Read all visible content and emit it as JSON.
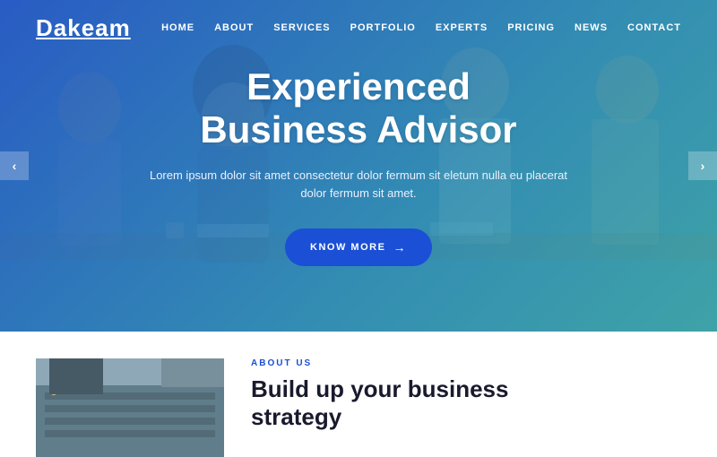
{
  "header": {
    "logo": "Dakeam",
    "nav": [
      {
        "label": "HOME"
      },
      {
        "label": "ABOUT"
      },
      {
        "label": "SERVICES"
      },
      {
        "label": "PORTFOLIO"
      },
      {
        "label": "EXPERTS"
      },
      {
        "label": "PRICING"
      },
      {
        "label": "NEWS"
      },
      {
        "label": "CONTACT"
      }
    ]
  },
  "hero": {
    "title_line1": "Experienced",
    "title_line2": "Business Advisor",
    "description": "Lorem ipsum dolor sit amet consectetur dolor fermum sit eletum\nnulla eu placerat dolor fermum sit amet.",
    "cta_label": "KNOW MORE",
    "slider_left": "‹",
    "slider_right": "›"
  },
  "about": {
    "label": "ABOUT US",
    "title_line1": "Build up your business",
    "title_line2": "strategy"
  },
  "colors": {
    "brand_blue": "#1a4fd6",
    "dark": "#1a1a2e",
    "white": "#ffffff"
  }
}
